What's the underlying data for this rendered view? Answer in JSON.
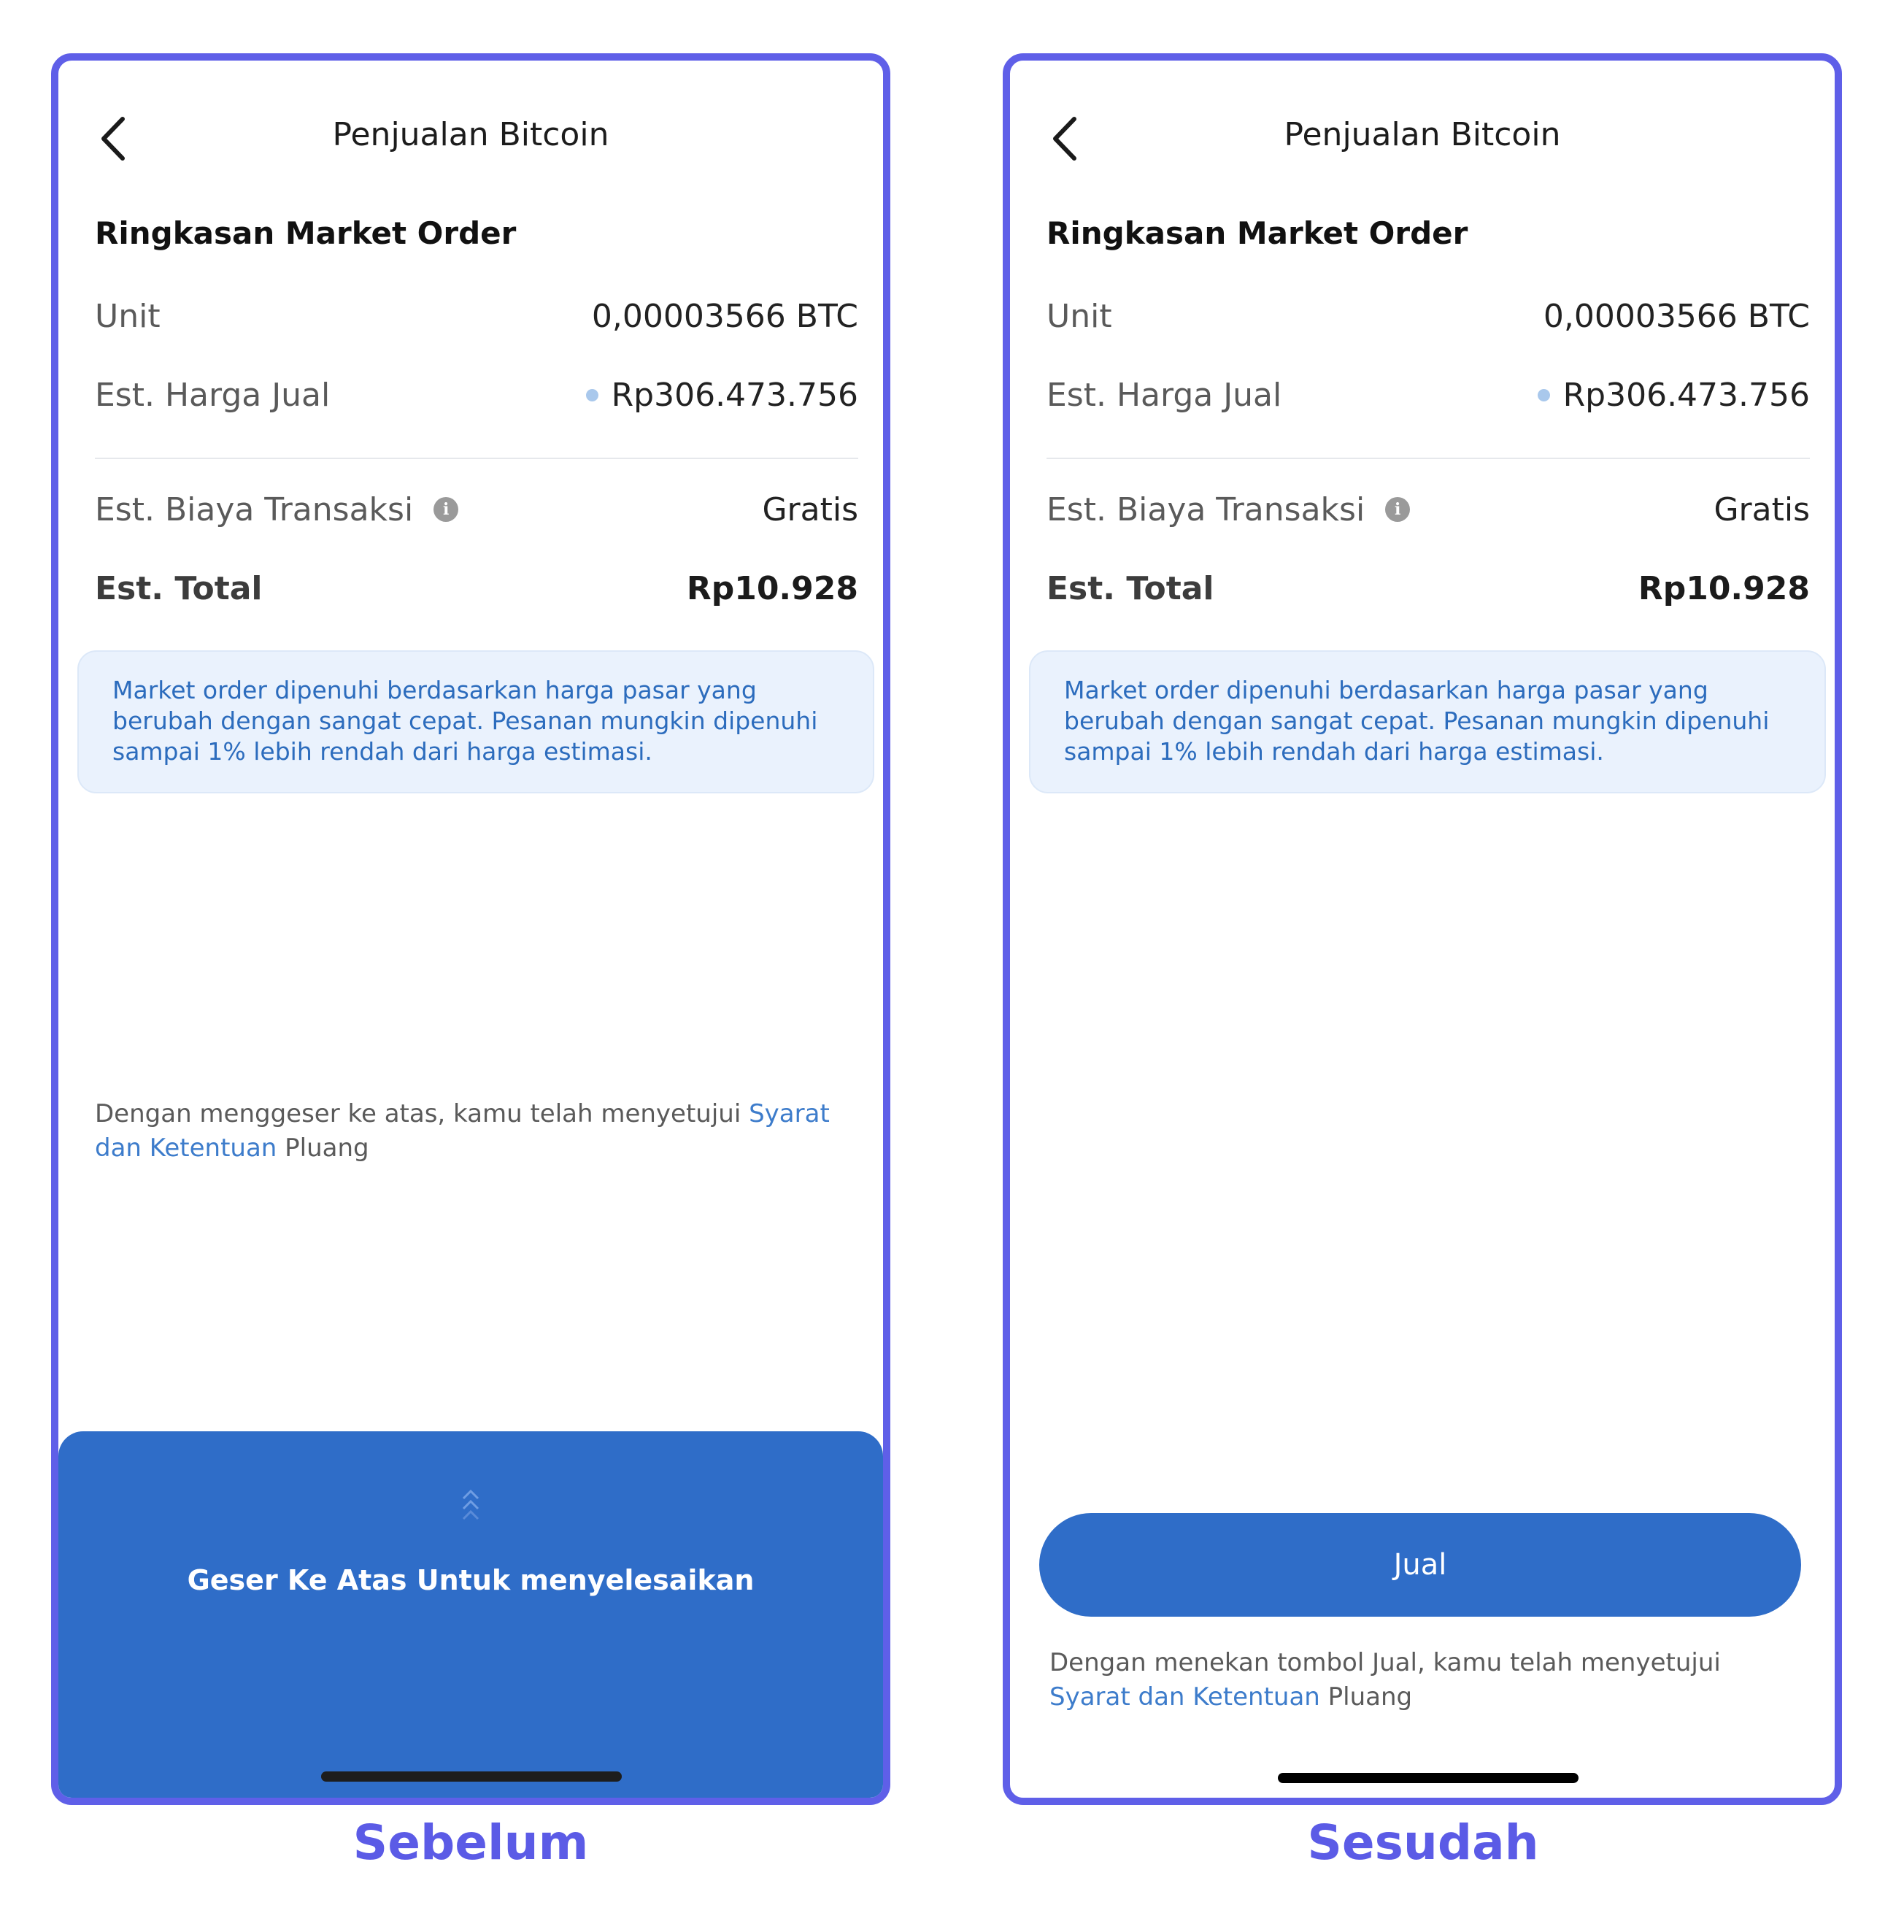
{
  "colors": {
    "frame": "#5f5fe8",
    "accent": "#2f6dc8",
    "link": "#3d7ccb",
    "notice_bg": "#eaf2fd",
    "caption": "#5b5be6"
  },
  "screens": [
    {
      "caption": "Sebelum",
      "header": {
        "back_icon": "chevron-left-icon",
        "title": "Penjualan Bitcoin"
      },
      "summary": {
        "heading": "Ringkasan Market Order",
        "unit_label": "Unit",
        "unit_value": "0,00003566 BTC",
        "price_label": "Est. Harga Jual",
        "price_value": "Rp306.473.756",
        "fee_label": "Est. Biaya Transaksi",
        "fee_info_icon": "info-icon",
        "fee_value": "Gratis",
        "total_label": "Est. Total",
        "total_value": "Rp10.928"
      },
      "notice": "Market order dipenuhi berdasarkan harga pasar yang berubah dengan sangat cepat. Pesanan mungkin dipenuhi sampai 1% lebih rendah dari harga estimasi.",
      "terms": {
        "prefix": "Dengan menggeser ke atas, kamu telah menyetujui ",
        "link": "Syarat dan Ketentuan",
        "suffix": " Pluang"
      },
      "swipe": {
        "icon": "double-chevron-up-icon",
        "label": "Geser Ke Atas Untuk menyelesaikan"
      }
    },
    {
      "caption": "Sesudah",
      "header": {
        "back_icon": "chevron-left-icon",
        "title": "Penjualan Bitcoin"
      },
      "summary": {
        "heading": "Ringkasan Market Order",
        "unit_label": "Unit",
        "unit_value": "0,00003566 BTC",
        "price_label": "Est. Harga Jual",
        "price_value": "Rp306.473.756",
        "fee_label": "Est. Biaya Transaksi",
        "fee_info_icon": "info-icon",
        "fee_value": "Gratis",
        "total_label": "Est. Total",
        "total_value": "Rp10.928"
      },
      "notice": "Market order dipenuhi berdasarkan harga pasar yang berubah dengan sangat cepat. Pesanan mungkin dipenuhi sampai 1% lebih rendah dari harga estimasi.",
      "button_label": "Jual",
      "terms": {
        "prefix": "Dengan menekan tombol Jual, kamu telah menyetujui ",
        "link": "Syarat dan Ketentuan",
        "suffix": " Pluang"
      }
    }
  ]
}
